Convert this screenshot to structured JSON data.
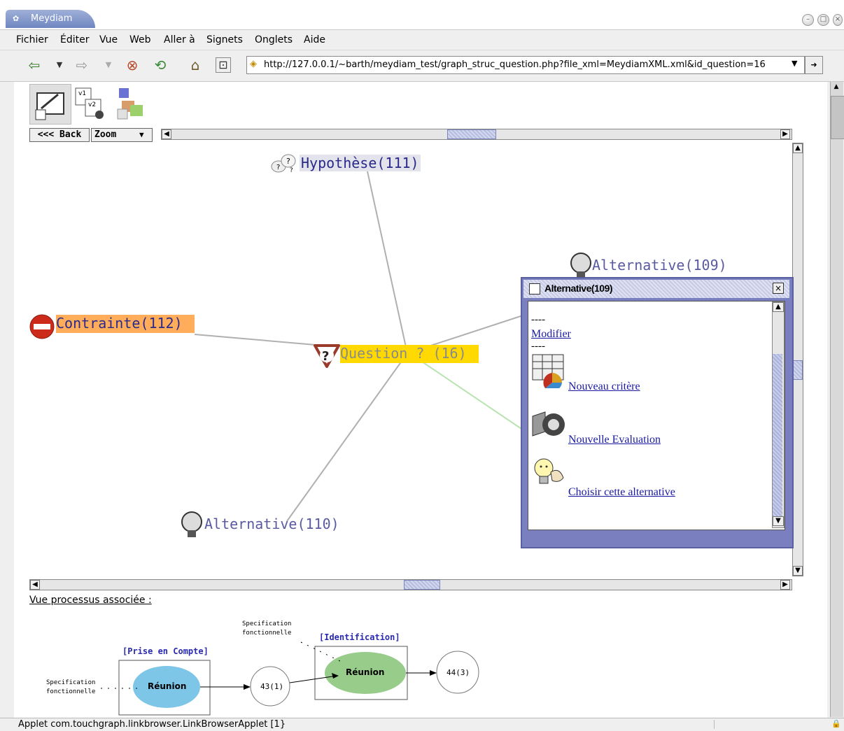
{
  "window": {
    "title": "Meydiam"
  },
  "menu": [
    "Fichier",
    "Éditer",
    "Vue",
    "Web",
    "Aller à",
    "Signets",
    "Onglets",
    "Aide"
  ],
  "url": "http://127.0.0.1/~barth/meydiam_test/graph_struc_question.php?file_xml=MeydiamXML.xml&id_question=16",
  "applet_controls": {
    "back": "<<< Back",
    "zoom": "Zoom"
  },
  "graph": {
    "nodes": {
      "hypothese": "Hypothèse(111)",
      "alternative109": "Alternative(109)",
      "contrainte": "Contrainte(112)",
      "question": "Question ? (16)",
      "alternative110": "Alternative(110)"
    },
    "colors": {
      "question_bg": "#ffd900",
      "contrainte_bg": "#ffad5a",
      "hypothese_bg": "#e3e3ec",
      "node_text": "#2a2a8a"
    }
  },
  "popup": {
    "title": "Alternative(109)",
    "separator": "----",
    "modifier": "Modifier",
    "items": [
      "Nouveau critère",
      "Nouvelle Evaluation",
      "Choisir cette alternative"
    ]
  },
  "process": {
    "heading": "Vue processus associée :",
    "spec1": "Specification fonctionnelle",
    "spec2": "Specification fonctionnelle",
    "label_prise": "[Prise en Compte]",
    "label_ident": "[Identification]",
    "reunion1": "Réunion",
    "reunion2": "Réunion",
    "node43": "43(1)",
    "node44": "44(3)"
  },
  "status": "Applet com.touchgraph.linkbrowser.LinkBrowserApplet [1}"
}
